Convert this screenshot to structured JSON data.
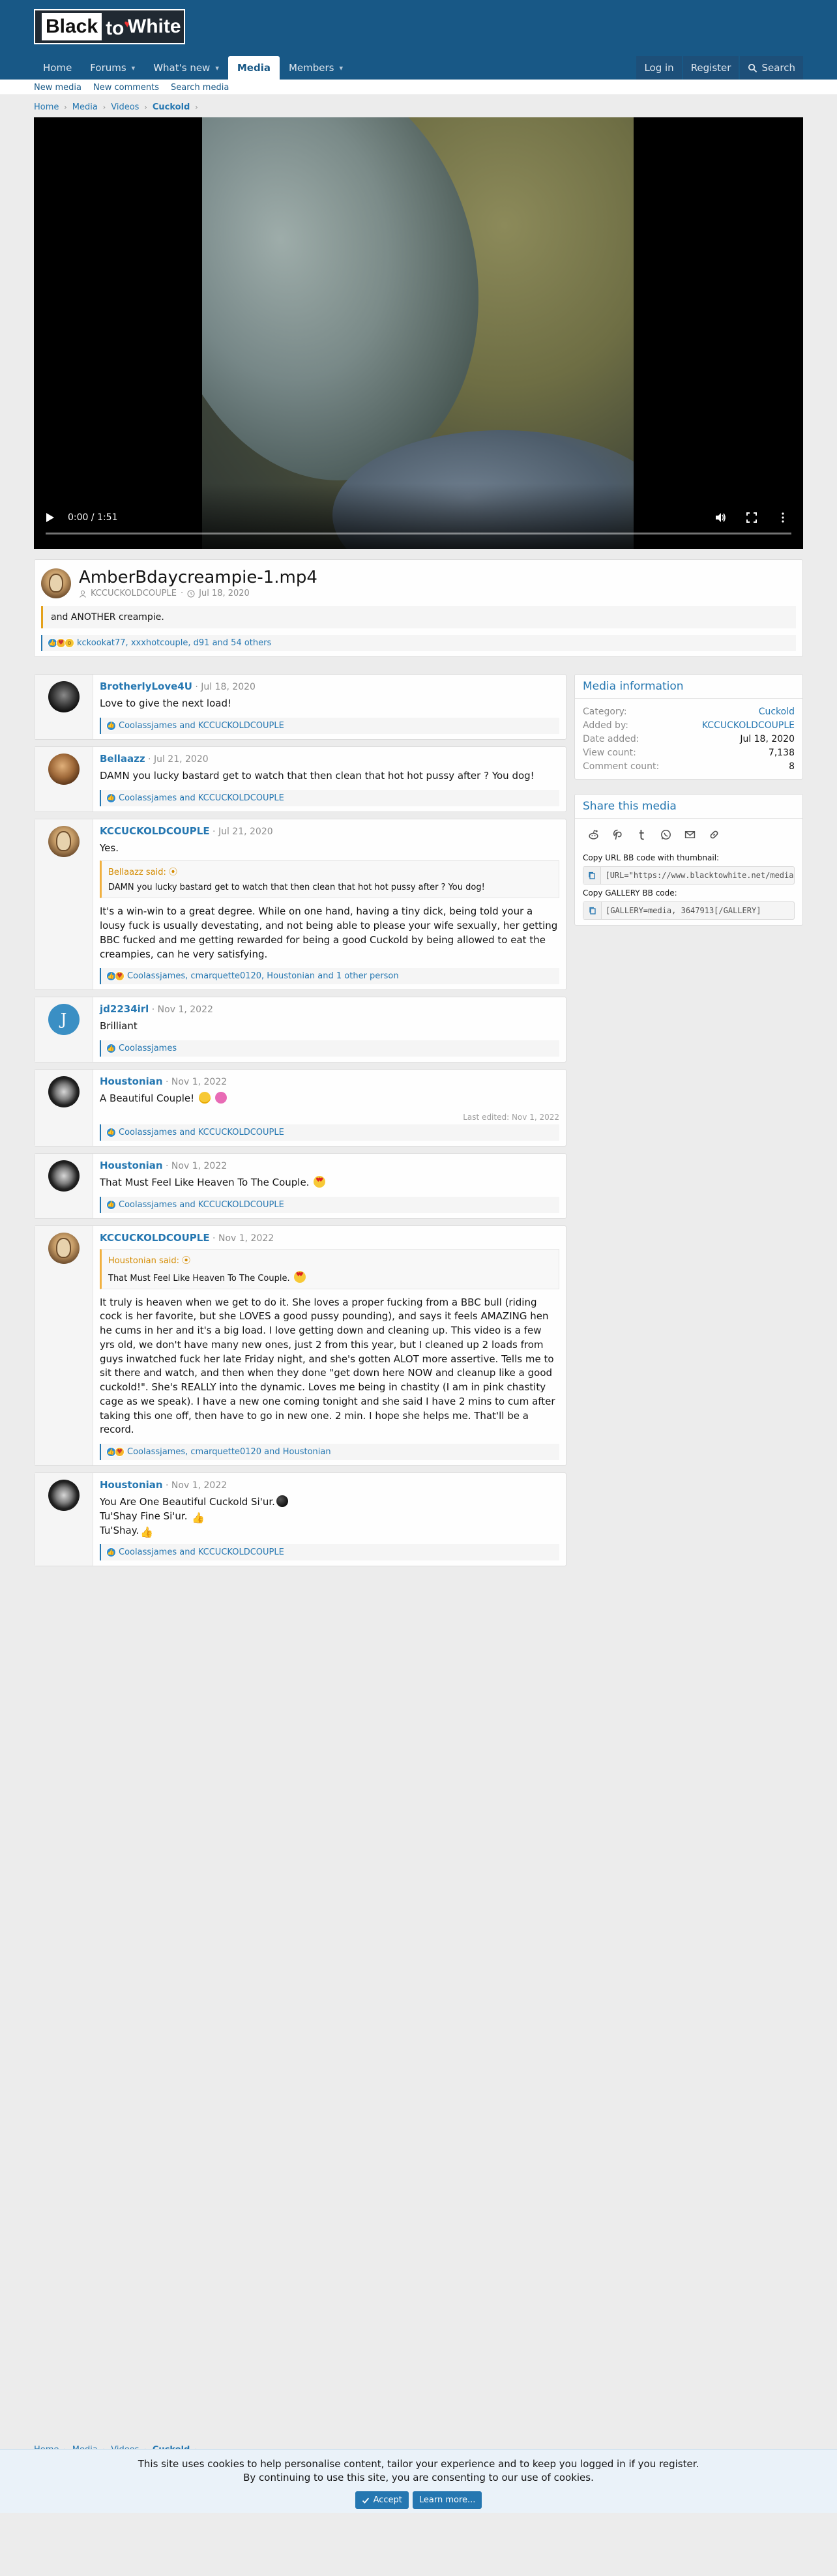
{
  "brand": {
    "logo_black": "Black",
    "logo_to": "to",
    "logo_white": "White"
  },
  "nav": {
    "items": [
      {
        "label": "Home"
      },
      {
        "label": "Forums"
      },
      {
        "label": "What's new"
      },
      {
        "label": "Media"
      },
      {
        "label": "Members"
      }
    ],
    "login": "Log in",
    "register": "Register",
    "search": "Search"
  },
  "subnav": [
    "New media",
    "New comments",
    "Search media"
  ],
  "breadcrumb": [
    "Home",
    "Media",
    "Videos",
    "Cuckold"
  ],
  "video": {
    "time": "0:00 / 1:51"
  },
  "media": {
    "title": "AmberBdaycreampie-1.mp4",
    "author": "KCCUCKOLDCOUPLE",
    "date": "Jul 18, 2020",
    "description": "and ANOTHER creampie.",
    "reactions": "kckookat77, xxxhotcouple, d91 and 54 others"
  },
  "comments": [
    {
      "user": "BrotherlyLove4U",
      "date": "Jul 18, 2020",
      "text": "Love to give the next load!",
      "reactions": "Coolassjames and KCCUCKOLDCOUPLE"
    },
    {
      "user": "Bellaazz",
      "date": "Jul 21, 2020",
      "text": "DAMN you lucky bastard get to watch that then clean that hot hot pussy after ? You dog!",
      "reactions": "Coolassjames and KCCUCKOLDCOUPLE"
    },
    {
      "user": "KCCUCKOLDCOUPLE",
      "date": "Jul 21, 2020",
      "text": "Yes.",
      "quote_head": "Bellaazz said: ⦿",
      "quote_body": "DAMN you lucky bastard get to watch that then clean that hot hot pussy after ? You dog!",
      "text2": "It's a win-win to a great degree. While on one hand, having a tiny dick, being told your a lousy fuck is usually devestating, and not being able to please your wife sexually, her getting BBC fucked and me getting rewarded for being a good Cuckold by being allowed to eat the creampies, can he very satisfying.",
      "reactions": "Coolassjames, cmarquette0120, Houstonian and 1 other person"
    },
    {
      "user": "jd2234irl",
      "date": "Nov 1, 2022",
      "text": "Brilliant",
      "reactions": "Coolassjames"
    },
    {
      "user": "Houstonian",
      "date": "Nov 1, 2022",
      "text": "A Beautiful Couple!",
      "edited": "Last edited: Nov 1, 2022",
      "reactions": "Coolassjames and KCCUCKOLDCOUPLE"
    },
    {
      "user": "Houstonian",
      "date": "Nov 1, 2022",
      "text": "That Must Feel Like Heaven To The Couple.",
      "reactions": "Coolassjames and KCCUCKOLDCOUPLE"
    },
    {
      "user": "KCCUCKOLDCOUPLE",
      "date": "Nov 1, 2022",
      "quote_head": "Houstonian said: ⦿",
      "quote_body": "That Must Feel Like Heaven To The Couple.",
      "text2": "It truly is heaven when we get to do it. She loves a proper fucking from a BBC bull (riding cock is her favorite, but she LOVES a good pussy pounding), and says it feels AMAZING hen he cums in her and it's a big load. I love getting down and cleaning up. This video is a few yrs old, we don't have many new ones, just 2 from this year, but I cleaned up 2 loads from guys inwatched fuck her late Friday night, and she's gotten ALOT more assertive. Tells me to sit there and watch, and then when they done \"get down here NOW and cleanup like a good cuckold!\". She's REALLY into the dynamic. Loves me being in chastity (I am in pink chastity cage as we speak). I have a new one coming tonight and she said I have 2 mins to cum after taking this one off, then have to go in new one. 2 min. I hope she helps me. That'll be a record.",
      "reactions": "Coolassjames, cmarquette0120 and Houstonian"
    },
    {
      "user": "Houstonian",
      "date": "Nov 1, 2022",
      "line1": "You Are One Beautiful Cuckold Si'ur.",
      "line2": "Tu'Shay Fine Si'ur.",
      "line3": "Tu'Shay.",
      "reactions": "Coolassjames and KCCUCKOLDCOUPLE"
    }
  ],
  "sidebar": {
    "info_title": "Media information",
    "info": [
      {
        "k": "Category:",
        "v": "Cuckold"
      },
      {
        "k": "Added by:",
        "v": "KCCUCKOLDCOUPLE"
      },
      {
        "k": "Date added:",
        "v": "Jul 18, 2020"
      },
      {
        "k": "View count:",
        "v": "7,138"
      },
      {
        "k": "Comment count:",
        "v": "8"
      }
    ],
    "share_title": "Share this media",
    "copy_url_label": "Copy URL BB code with thumbnail:",
    "copy_url_value": "[URL=\"https://www.blacktowhite.net/media",
    "copy_gallery_label": "Copy GALLERY BB code:",
    "copy_gallery_value": "[GALLERY=media, 3647913[/GALLERY]"
  },
  "cookie": {
    "line1": "This site uses cookies to help personalise content, tailor your experience and to keep you logged in if you register.",
    "line2": "By continuing to use this site, you are consenting to our use of cookies.",
    "accept": "Accept",
    "learn": "Learn more..."
  }
}
